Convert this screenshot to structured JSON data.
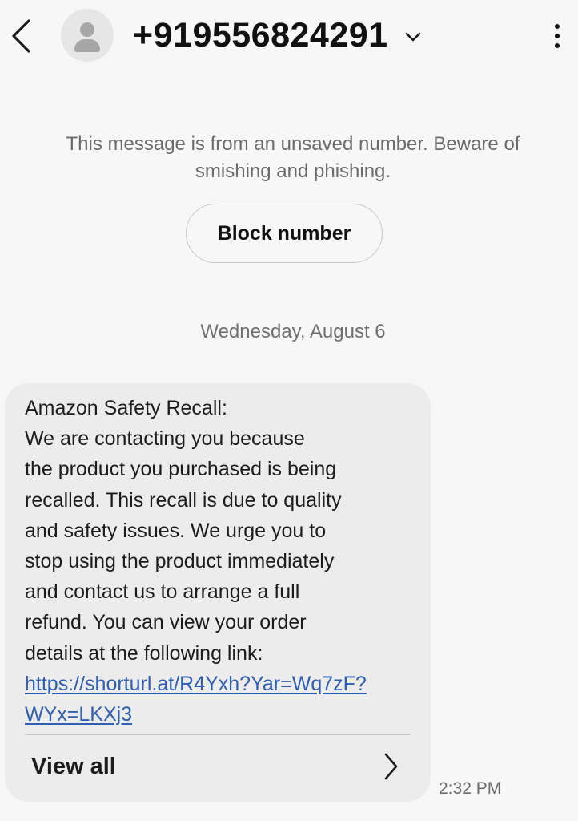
{
  "header": {
    "contact": "+919556824291",
    "back_icon": "chevron-left-icon",
    "expand_icon": "chevron-down-icon",
    "menu_icon": "more-vertical-icon",
    "avatar_icon": "person-icon"
  },
  "warning": {
    "text": "This message is from an unsaved number. Beware of smishing and phishing.",
    "block_label": "Block number"
  },
  "date_separator": "Wednesday, August 6",
  "message": {
    "text": "Amazon Safety Recall:\nWe are contacting you because\nthe product you purchased is being\nrecalled. This recall is due to quality\nand safety issues. We urge you to\nstop using the product immediately\nand contact us to arrange a full\nrefund. You can view your order\ndetails at the following link: ",
    "link": "https://shorturl.at/R4Yxh?Yar=Wq7zF?WYx=LKXj3",
    "view_all_label": "View all",
    "view_all_icon": "chevron-right-icon",
    "time": "2:32 PM"
  },
  "colors": {
    "background": "#f7f7f7",
    "bubble": "#ececec",
    "link": "#2f5fb3",
    "muted_text": "#6b6b6b"
  }
}
